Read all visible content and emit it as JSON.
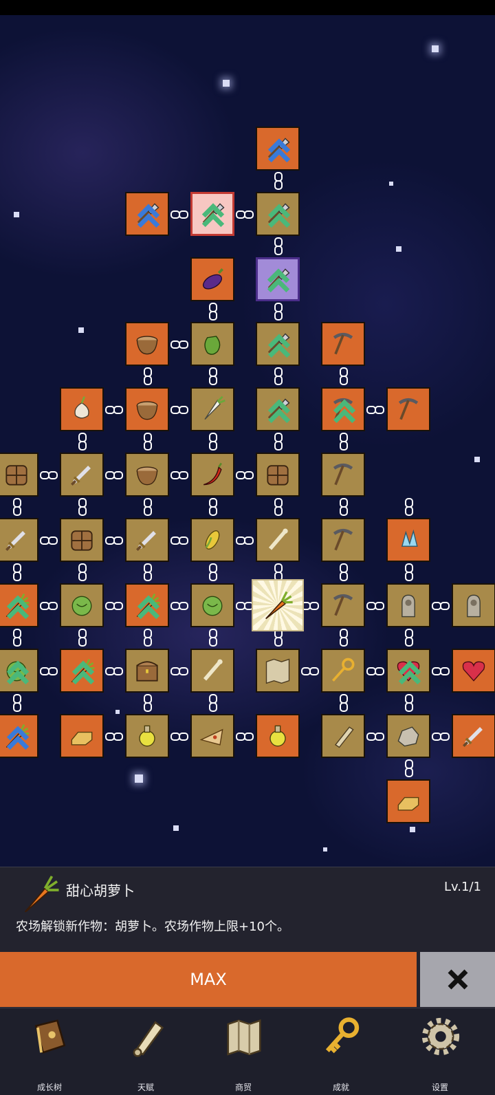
{
  "detail": {
    "title": "甜心胡萝卜",
    "level": "Lv.1/1",
    "description": "农场解锁新作物：胡萝卜。农场作物上限+10个。",
    "max_label": "MAX",
    "close_icon": "close-x-icon"
  },
  "nav": [
    {
      "label": "成长树",
      "icon": "book-icon"
    },
    {
      "label": "天赋",
      "icon": "scroll-icon"
    },
    {
      "label": "商贸",
      "icon": "map-icon"
    },
    {
      "label": "成就",
      "icon": "key-icon"
    },
    {
      "label": "设置",
      "icon": "gear-icon"
    }
  ],
  "tree_icons": [
    "shovel-icon",
    "eggplant-icon",
    "pepper-icon",
    "bowl-icon",
    "garlic-icon",
    "radish-icon",
    "chili-icon",
    "sword-icon",
    "crate-icon",
    "corn-icon",
    "pickaxe-icon",
    "crystal-icon",
    "carrot-icon",
    "cabbage-icon",
    "statue-icon",
    "chest-icon",
    "bone-icon",
    "map-icon",
    "key-icon",
    "heart-icon",
    "gold-bar-icon",
    "potion-icon",
    "pizza-icon",
    "scroll-icon",
    "rock-icon"
  ],
  "colors": {
    "orange_tile": "#d9692c",
    "gold_tile": "#a88a4a",
    "panel": "#23232e",
    "nav": "#1e1f2b"
  }
}
